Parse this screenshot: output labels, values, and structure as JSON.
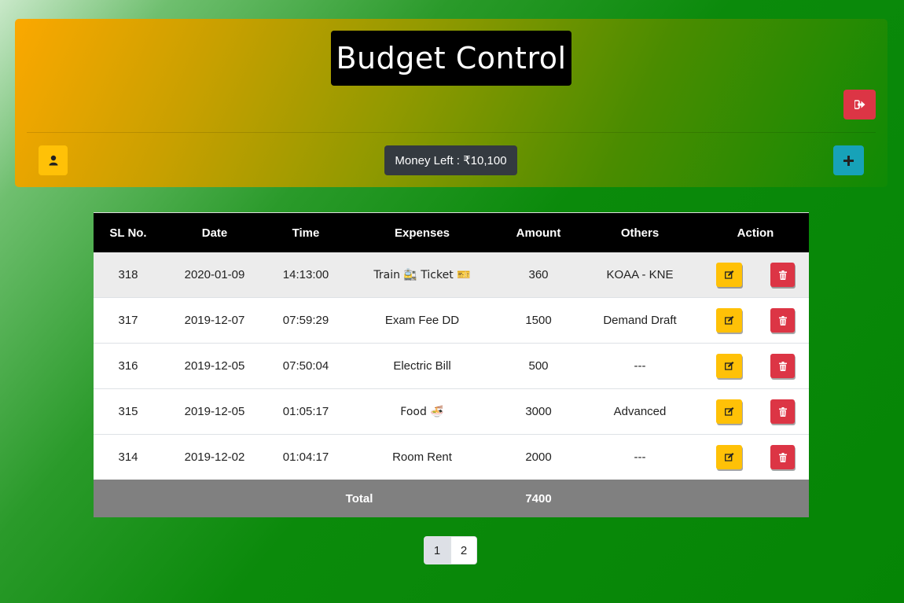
{
  "header": {
    "title": "Budget Control",
    "money_left": "Money Left : ₹10,100",
    "logout_icon": "sign-out-icon",
    "user_icon": "user-icon",
    "add_icon": "plus-icon"
  },
  "table": {
    "columns": [
      "SL No.",
      "Date",
      "Time",
      "Expenses",
      "Amount",
      "Others",
      "Action"
    ],
    "rows": [
      {
        "sl": "318",
        "date": "2020-01-09",
        "time": "14:13:00",
        "expense": "Train 🚉 Ticket 🎫",
        "amount": "360",
        "others": "KOAA - KNE"
      },
      {
        "sl": "317",
        "date": "2019-12-07",
        "time": "07:59:29",
        "expense": "Exam Fee DD",
        "amount": "1500",
        "others": "Demand Draft"
      },
      {
        "sl": "316",
        "date": "2019-12-05",
        "time": "07:50:04",
        "expense": "Electric Bill",
        "amount": "500",
        "others": "---"
      },
      {
        "sl": "315",
        "date": "2019-12-05",
        "time": "01:05:17",
        "expense": "Food 🍜",
        "amount": "3000",
        "others": "Advanced"
      },
      {
        "sl": "314",
        "date": "2019-12-02",
        "time": "01:04:17",
        "expense": "Room Rent",
        "amount": "2000",
        "others": "---"
      }
    ],
    "total_label": "Total",
    "total_amount": "7400"
  },
  "pagination": {
    "pages": [
      "1",
      "2"
    ],
    "active": "1"
  },
  "colors": {
    "logout": "#dc3545",
    "user": "#ffc107",
    "add": "#17a2b8",
    "edit": "#ffc107",
    "delete": "#dc3545",
    "money_badge": "#343a40"
  }
}
